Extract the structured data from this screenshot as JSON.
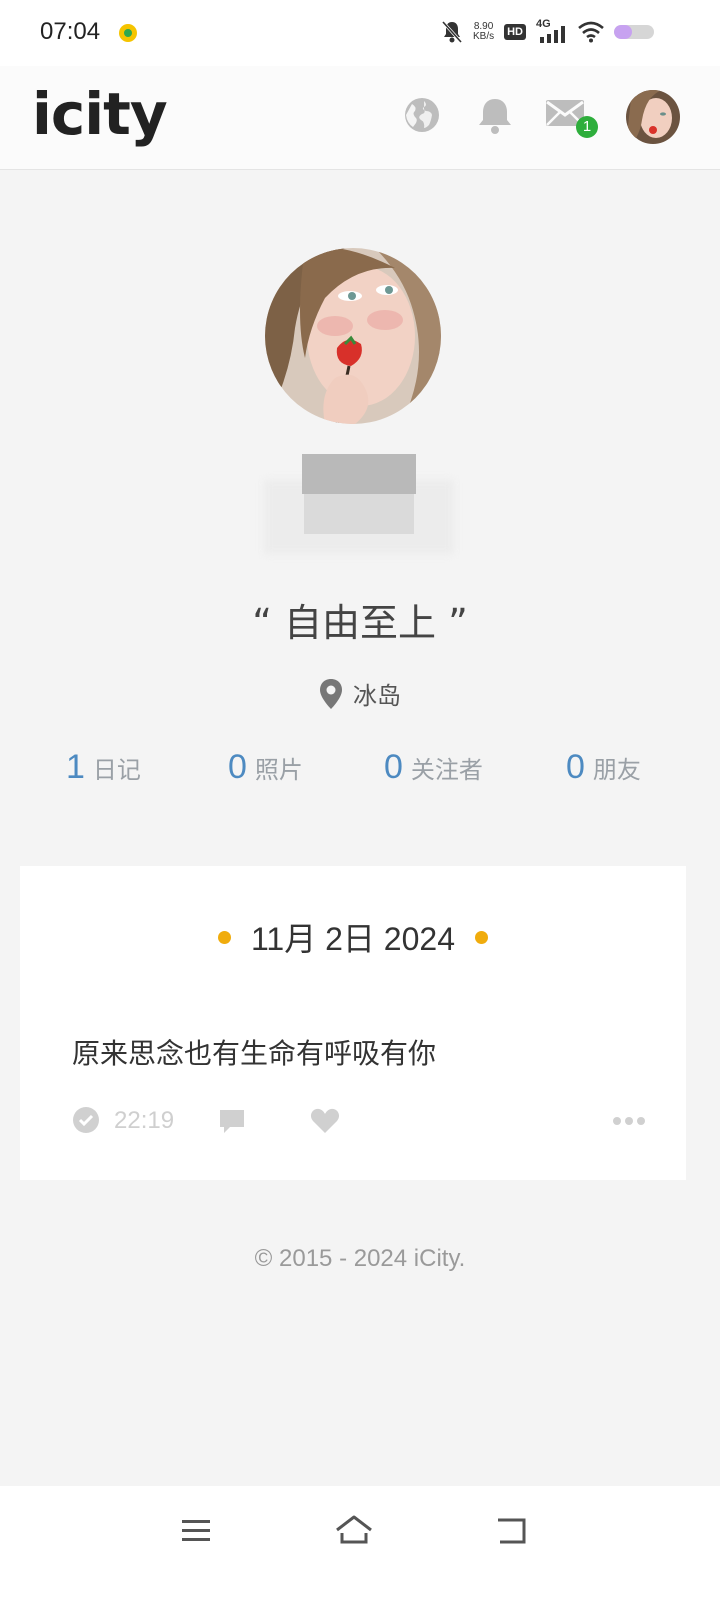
{
  "status_bar": {
    "time": "07:04",
    "net_speed_value": "8.90",
    "net_speed_unit": "KB/s",
    "hd_label": "HD",
    "network_label": "4G",
    "battery_level": 0.45
  },
  "header": {
    "logo": "icity",
    "mail_badge_count": "1"
  },
  "profile": {
    "motto": "“ 自由至上 ”",
    "location": "冰岛",
    "stats": [
      {
        "value": "1",
        "label": "日记"
      },
      {
        "value": "0",
        "label": "照片"
      },
      {
        "value": "0",
        "label": "关注者"
      },
      {
        "value": "0",
        "label": "朋友"
      }
    ]
  },
  "entry": {
    "date": "11月 2日 2024",
    "text": "原来思念也有生命有呼吸有你",
    "time": "22:19"
  },
  "footer": {
    "copyright": "© 2015 - 2024 iCity."
  },
  "colors": {
    "accent_blue": "#4d8ac1",
    "date_dot": "#f0ac0d",
    "badge_green": "#2eae3c"
  }
}
